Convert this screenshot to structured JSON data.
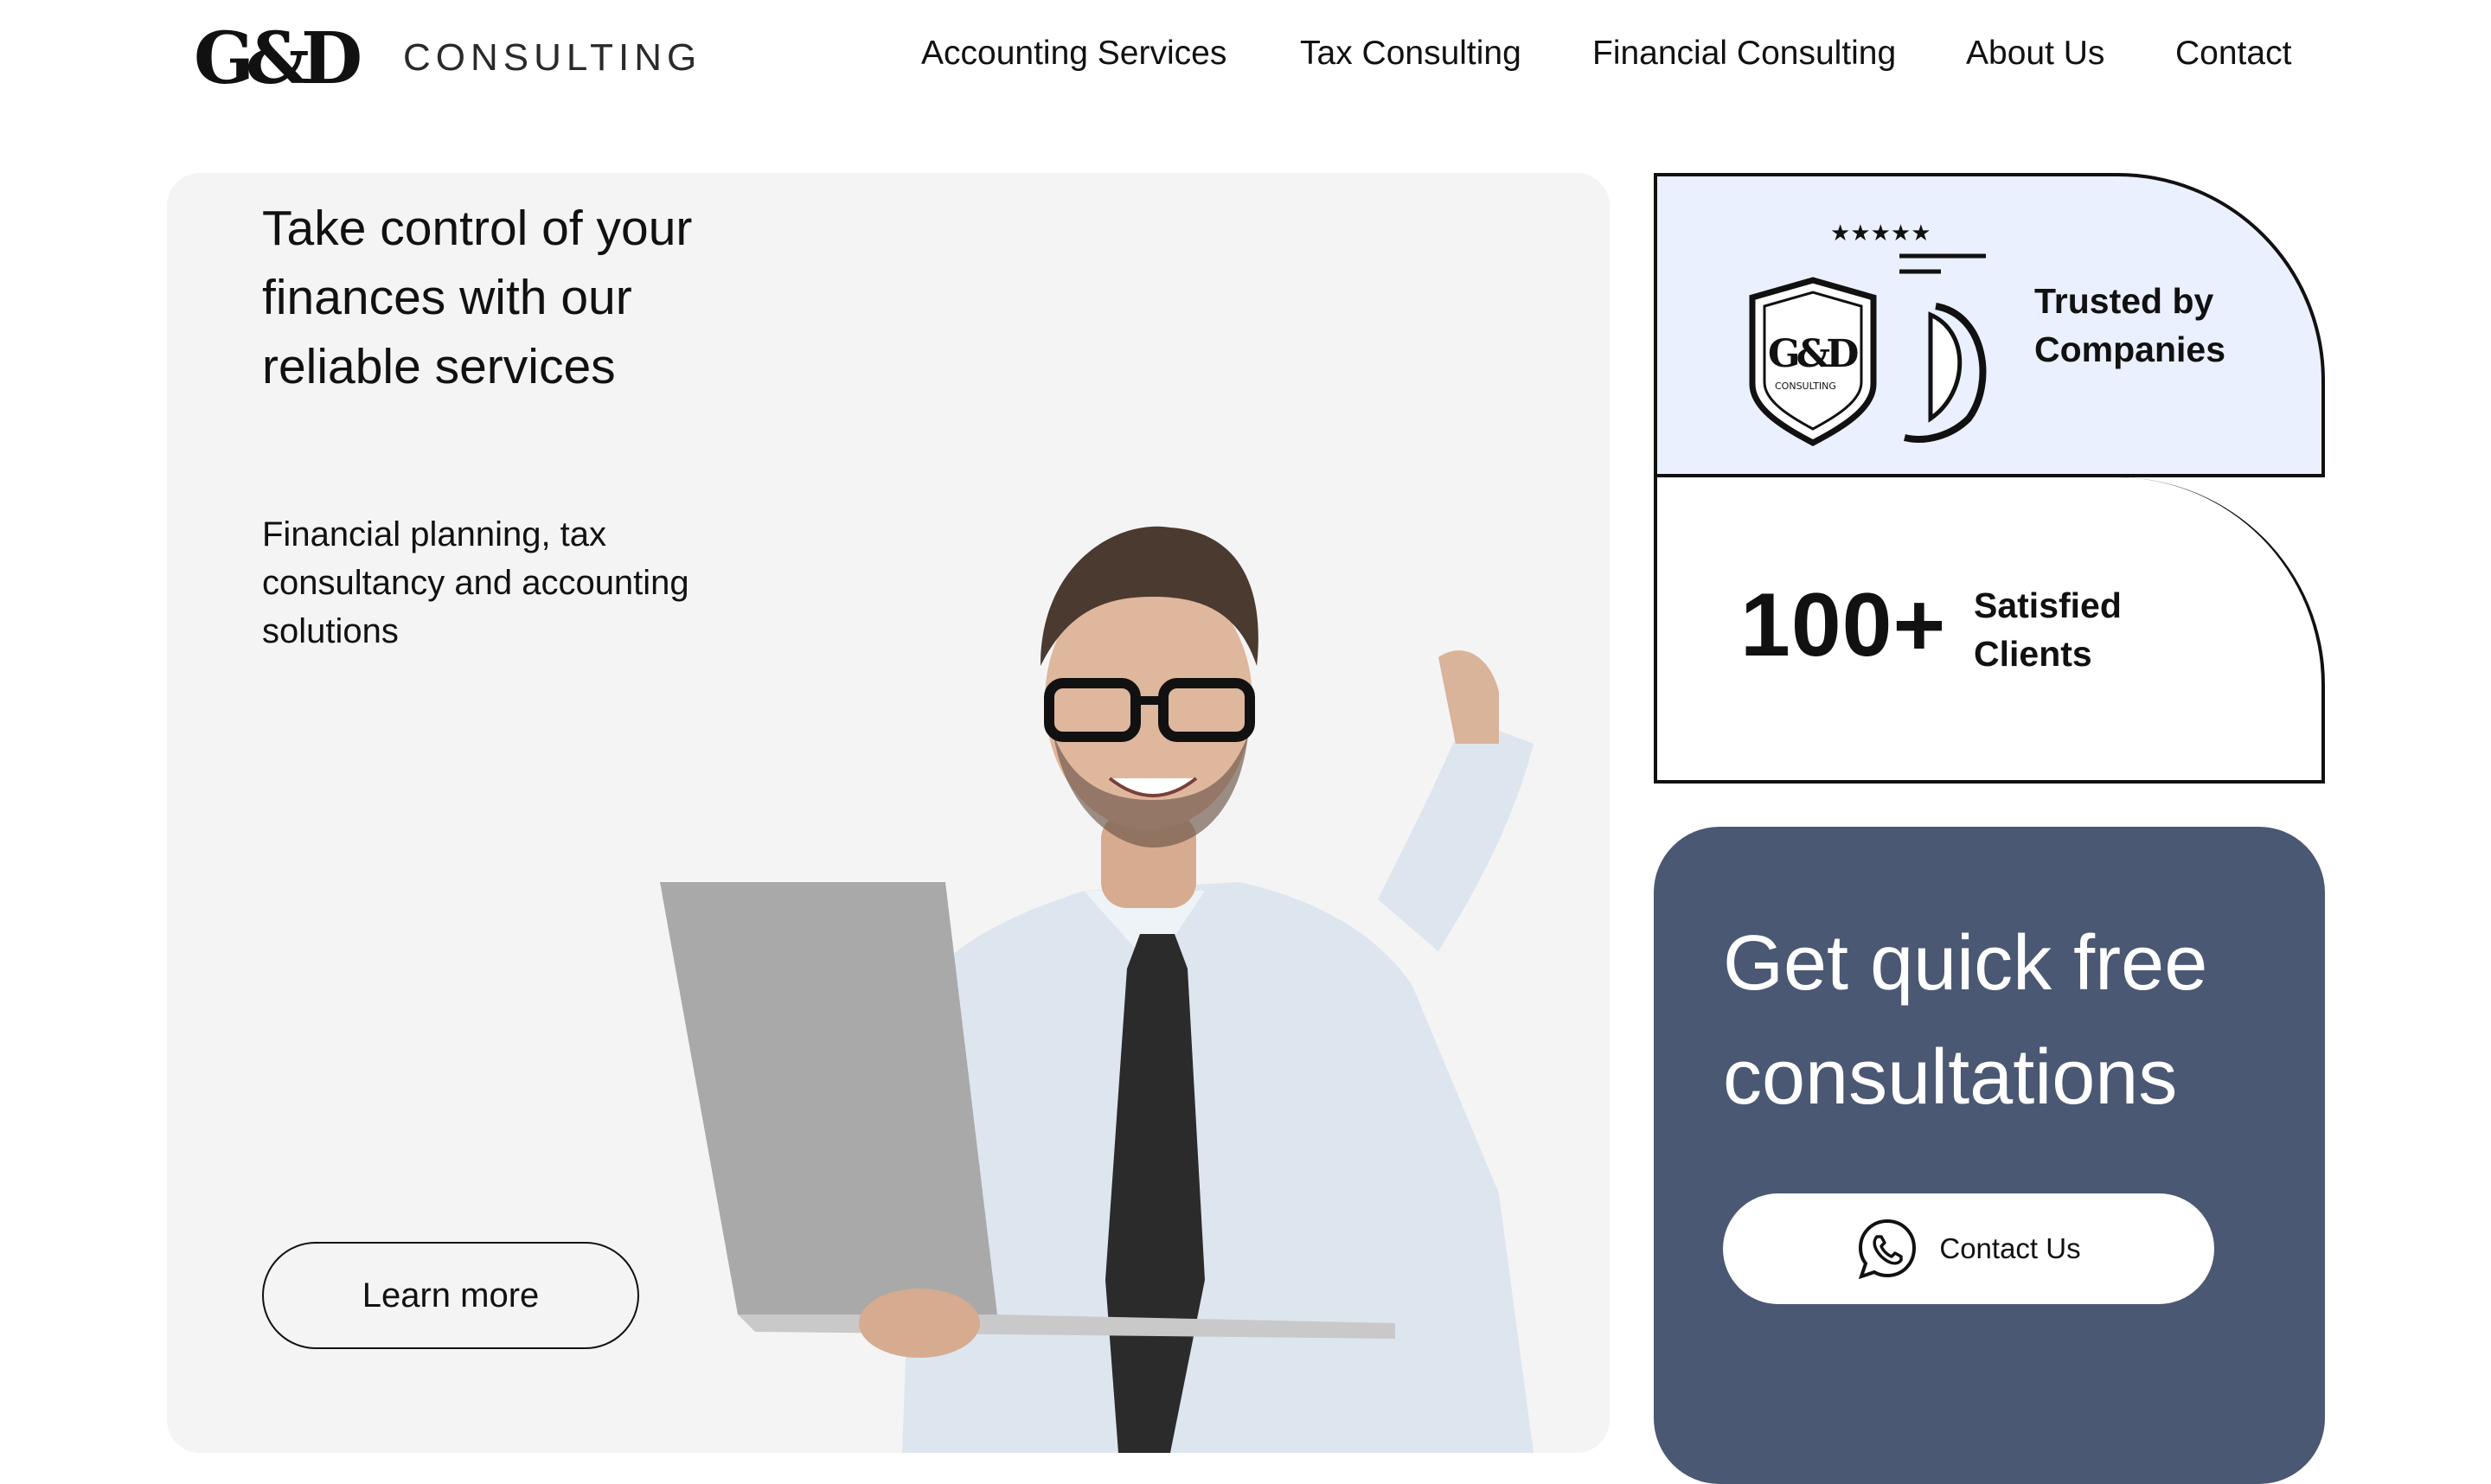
{
  "header": {
    "logo_mark_text": "G&D",
    "logo_word": "CONSULTING",
    "nav": [
      {
        "label": "Accounting Services"
      },
      {
        "label": "Tax Consulting"
      },
      {
        "label": "Financial Consulting"
      },
      {
        "label": "About Us"
      },
      {
        "label": "Contact"
      }
    ]
  },
  "hero": {
    "title": "Take control of your finances with our reliable services",
    "subtitle": "Financial planning, tax consultancy and accounting solutions",
    "learn_more": "Learn more",
    "image": "man-with-laptop-photo"
  },
  "trusted": {
    "label": "Trusted by Companies",
    "badge_text": "G&D",
    "badge_sub": "CONSULTING",
    "stars": "★★★★★",
    "icon": "shield-badge-icon"
  },
  "clients": {
    "count": "100+",
    "label": "Satisfied Clients"
  },
  "consult": {
    "title": "Get quick free consultations",
    "button_label": "Contact Us",
    "button_icon": "whatsapp-icon"
  },
  "colors": {
    "hero_bg": "#f4f4f4",
    "trusted_bg": "#eaf0fd",
    "consult_bg": "#4a5873"
  }
}
